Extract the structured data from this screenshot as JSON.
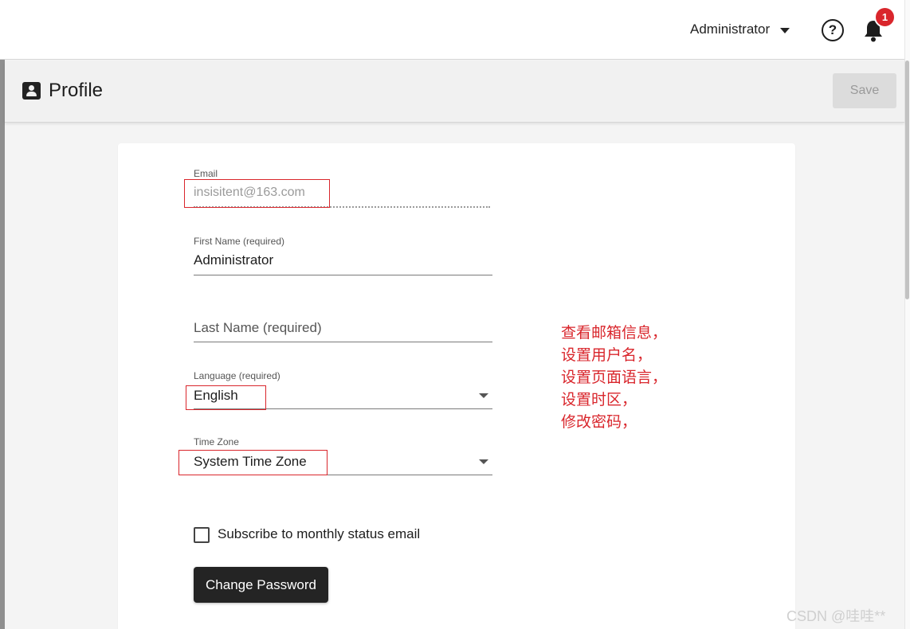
{
  "topbar": {
    "user_name": "Administrator",
    "notification_count": "1",
    "help_label": "?"
  },
  "header": {
    "title": "Profile",
    "save_label": "Save"
  },
  "form": {
    "email": {
      "label": "Email",
      "value": "insisitent@163.com"
    },
    "first_name": {
      "label": "First Name (required)",
      "value": "Administrator"
    },
    "last_name": {
      "placeholder": "Last Name (required)"
    },
    "language": {
      "label": "Language (required)",
      "value": "English"
    },
    "time_zone": {
      "label": "Time Zone",
      "value": "System Time Zone"
    },
    "subscribe_label": "Subscribe to monthly status email",
    "subscribe_checked": false,
    "change_password_label": "Change Password"
  },
  "annotation": {
    "lines": [
      "查看邮箱信息，",
      "设置用户名，",
      "设置页面语言，",
      "设置时区，",
      "修改密码，"
    ],
    "color": "#d9262c"
  },
  "watermark": "CSDN @哇哇**",
  "colors": {
    "primary_dark": "#242424",
    "badge": "#d9262c",
    "header_bg": "#f1f1f1",
    "page_bg": "#f4f4f4"
  }
}
